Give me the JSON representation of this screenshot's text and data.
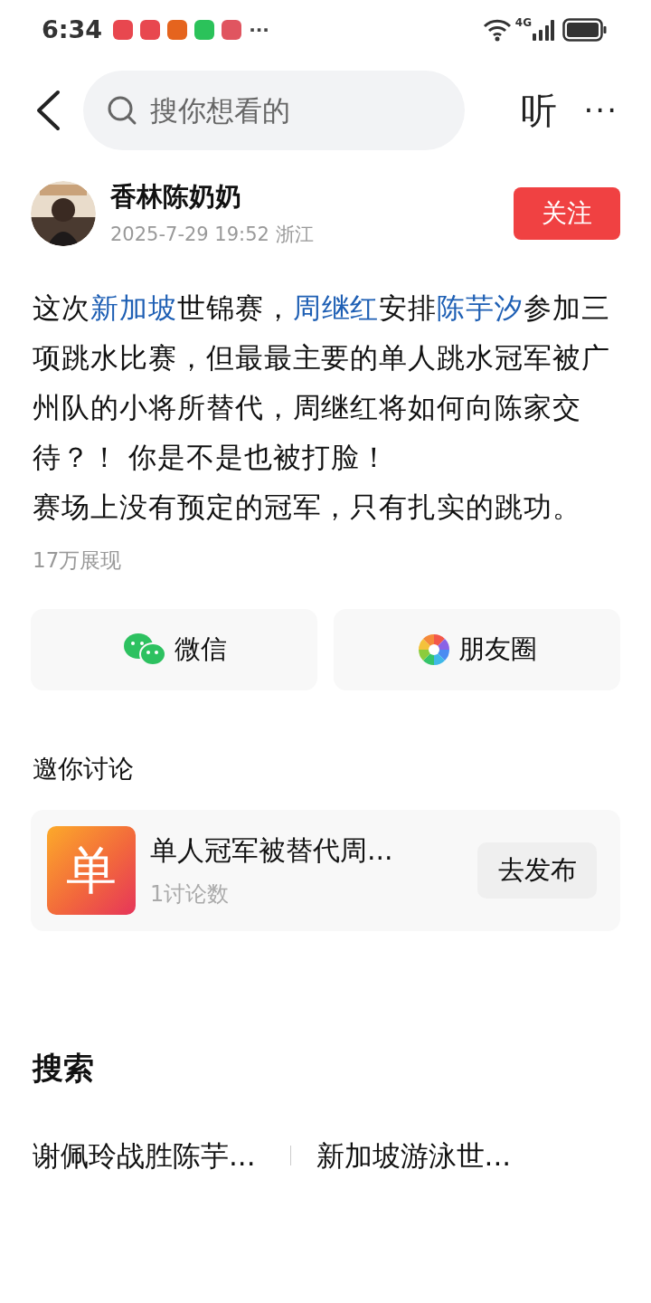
{
  "status_bar": {
    "time": "6:34",
    "app_icons": [
      {
        "color": "#e8474f"
      },
      {
        "color": "#e8474f"
      },
      {
        "color": "#e5641e"
      },
      {
        "color": "#2bc25a"
      },
      {
        "color": "#e05560"
      }
    ],
    "more": "···",
    "network": "4G"
  },
  "header": {
    "search": {
      "placeholder": "搜你想看的"
    },
    "listen": "听",
    "more": "···"
  },
  "author": {
    "name": "香林陈奶奶",
    "meta": "2025-7-29 19:52 浙江",
    "follow": "关注"
  },
  "post": {
    "segments": [
      {
        "kind": "plain",
        "text": "这次"
      },
      {
        "kind": "link",
        "text": "新加坡"
      },
      {
        "kind": "plain",
        "text": "世锦赛，"
      },
      {
        "kind": "link",
        "text": "周继红"
      },
      {
        "kind": "plain",
        "text": "安排"
      },
      {
        "kind": "link",
        "text": "陈芋汐"
      },
      {
        "kind": "plain",
        "text": "参加三项跳水比赛，但最最主要的单人跳水冠军被广州队的小将所替代，周继红将如何向陈家交待？！ 你是不是也被打脸！"
      },
      {
        "kind": "break"
      },
      {
        "kind": "plain",
        "text": "赛场上没有预定的冠军，只有扎实的跳功。"
      }
    ],
    "views": "17万展现"
  },
  "share": [
    {
      "kind": "wechat",
      "label": "微信"
    },
    {
      "kind": "moments",
      "label": "朋友圈"
    }
  ],
  "discussion": {
    "title": "邀你讨论",
    "topic": {
      "badge": "单",
      "title": "单人冠军被替代周...",
      "count": "1讨论数",
      "action": "去发布"
    }
  },
  "search_section": {
    "title": "搜索",
    "suggestions": [
      "谢佩玲战胜陈芋...",
      "新加坡游泳世..."
    ]
  }
}
